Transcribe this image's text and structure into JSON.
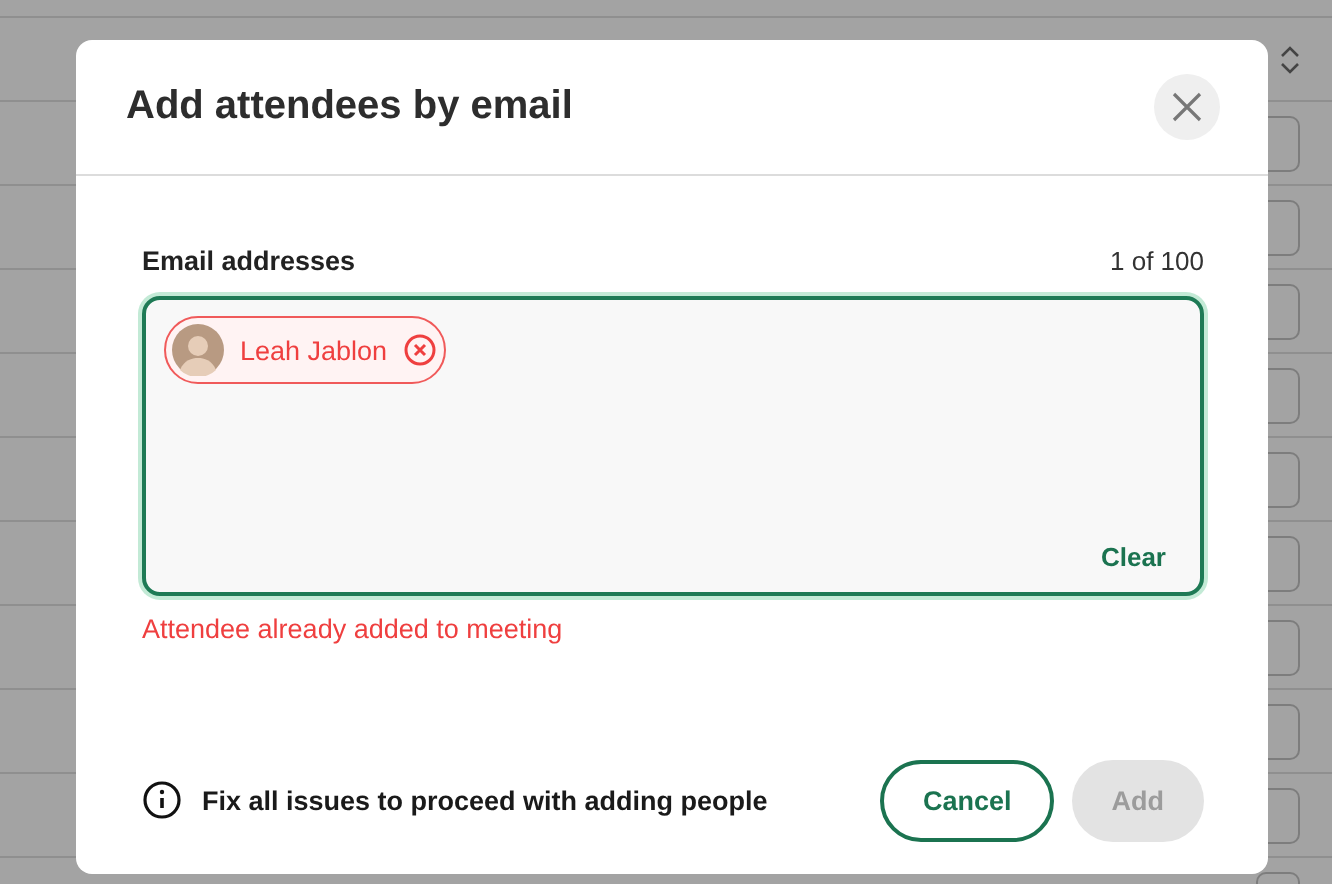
{
  "dialog": {
    "title": "Add attendees by email",
    "field": {
      "label": "Email addresses",
      "count": "1 of 100",
      "focused": true,
      "clear_label": "Clear",
      "chips": [
        {
          "name": "Leah Jablon",
          "error": true
        }
      ],
      "error": "Attendee already added to meeting"
    },
    "hint": "Fix all issues to proceed with adding people",
    "buttons": [
      {
        "label": "Cancel",
        "kind": "secondary",
        "disabled": false
      },
      {
        "label": "Add",
        "kind": "primary",
        "disabled": true
      }
    ]
  }
}
